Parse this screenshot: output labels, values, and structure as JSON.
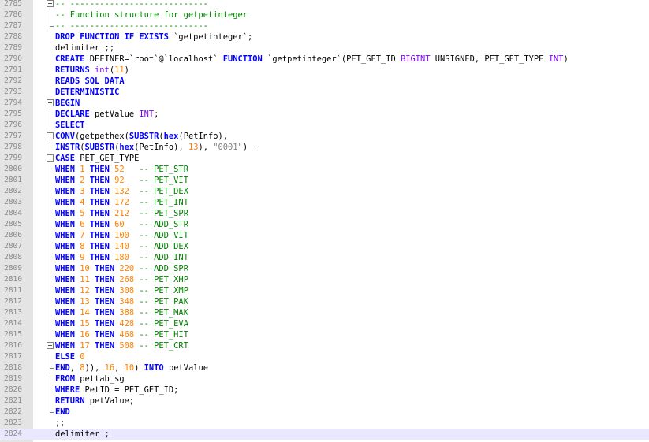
{
  "editor": {
    "lines": [
      {
        "n": "2785",
        "fold": "box",
        "tokens": [
          {
            "t": "cm",
            "v": "-- ----------------------------"
          }
        ]
      },
      {
        "n": "2786",
        "fold": "vline",
        "tokens": [
          {
            "t": "cm",
            "v": "-- Function structure for getpetinteger"
          }
        ]
      },
      {
        "n": "2787",
        "fold": "end",
        "tokens": [
          {
            "t": "cm",
            "v": "-- ----------------------------"
          }
        ]
      },
      {
        "n": "2788",
        "fold": "",
        "tokens": [
          {
            "t": "kw",
            "v": "DROP FUNCTION IF EXISTS "
          },
          {
            "t": "bq",
            "v": "`getpetinteger`"
          },
          {
            "t": "tx",
            "v": ";"
          }
        ]
      },
      {
        "n": "2789",
        "fold": "",
        "tokens": [
          {
            "t": "tx",
            "v": "delimiter ;;"
          }
        ]
      },
      {
        "n": "2790",
        "fold": "",
        "tokens": [
          {
            "t": "kw",
            "v": "CREATE "
          },
          {
            "t": "tx",
            "v": "DEFINER="
          },
          {
            "t": "bq",
            "v": "`root`"
          },
          {
            "t": "tx",
            "v": "@"
          },
          {
            "t": "bq",
            "v": "`localhost`"
          },
          {
            "t": "tx",
            "v": " "
          },
          {
            "t": "kw",
            "v": "FUNCTION "
          },
          {
            "t": "bq",
            "v": "`getpetinteger`"
          },
          {
            "t": "tx",
            "v": "(PET_GET_ID "
          },
          {
            "t": "ty",
            "v": "BIGINT"
          },
          {
            "t": "tx",
            "v": " UNSIGNED, PET_GET_TYPE "
          },
          {
            "t": "ty",
            "v": "INT"
          },
          {
            "t": "tx",
            "v": ")"
          }
        ]
      },
      {
        "n": "2791",
        "fold": "",
        "tokens": [
          {
            "t": "kw",
            "v": "RETURNS "
          },
          {
            "t": "ty",
            "v": "int"
          },
          {
            "t": "tx",
            "v": "("
          },
          {
            "t": "num",
            "v": "11"
          },
          {
            "t": "tx",
            "v": ")"
          }
        ]
      },
      {
        "n": "2792",
        "fold": "",
        "tokens": [
          {
            "t": "kw",
            "v": "READS SQL DATA"
          }
        ]
      },
      {
        "n": "2793",
        "fold": "",
        "tokens": [
          {
            "t": "kw",
            "v": "DETERMINISTIC"
          }
        ]
      },
      {
        "n": "2794",
        "fold": "box",
        "tokens": [
          {
            "t": "kw",
            "v": "BEGIN"
          }
        ]
      },
      {
        "n": "2795",
        "fold": "vline",
        "tokens": [
          {
            "t": "kw",
            "v": "DECLARE "
          },
          {
            "t": "tx",
            "v": "petValue "
          },
          {
            "t": "ty",
            "v": "INT"
          },
          {
            "t": "tx",
            "v": ";"
          }
        ]
      },
      {
        "n": "2796",
        "fold": "vline",
        "tokens": [
          {
            "t": "kw",
            "v": "SELECT"
          }
        ]
      },
      {
        "n": "2797",
        "fold": "box",
        "tokens": [
          {
            "t": "kw",
            "v": "CONV"
          },
          {
            "t": "tx",
            "v": "(getpethex("
          },
          {
            "t": "kw",
            "v": "SUBSTR"
          },
          {
            "t": "tx",
            "v": "("
          },
          {
            "t": "kw",
            "v": "hex"
          },
          {
            "t": "tx",
            "v": "(PetInfo),"
          }
        ]
      },
      {
        "n": "2798",
        "fold": "vline",
        "tokens": [
          {
            "t": "kw",
            "v": "INSTR"
          },
          {
            "t": "tx",
            "v": "("
          },
          {
            "t": "kw",
            "v": "SUBSTR"
          },
          {
            "t": "tx",
            "v": "("
          },
          {
            "t": "kw",
            "v": "hex"
          },
          {
            "t": "tx",
            "v": "(PetInfo), "
          },
          {
            "t": "num",
            "v": "13"
          },
          {
            "t": "tx",
            "v": "), "
          },
          {
            "t": "str",
            "v": "\"0001\""
          },
          {
            "t": "tx",
            "v": ") +"
          }
        ]
      },
      {
        "n": "2799",
        "fold": "box",
        "tokens": [
          {
            "t": "kw",
            "v": "CASE "
          },
          {
            "t": "tx",
            "v": "PET_GET_TYPE"
          }
        ]
      },
      {
        "n": "2800",
        "fold": "vline",
        "tokens": [
          {
            "t": "kw",
            "v": "WHEN "
          },
          {
            "t": "num",
            "v": "1"
          },
          {
            "t": "kw",
            "v": " THEN "
          },
          {
            "t": "num",
            "v": "52"
          },
          {
            "t": "tx",
            "v": "   "
          },
          {
            "t": "cm",
            "v": "-- PET_STR"
          }
        ]
      },
      {
        "n": "2801",
        "fold": "vline",
        "tokens": [
          {
            "t": "kw",
            "v": "WHEN "
          },
          {
            "t": "num",
            "v": "2"
          },
          {
            "t": "kw",
            "v": " THEN "
          },
          {
            "t": "num",
            "v": "92"
          },
          {
            "t": "tx",
            "v": "   "
          },
          {
            "t": "cm",
            "v": "-- PET_VIT"
          }
        ]
      },
      {
        "n": "2802",
        "fold": "vline",
        "tokens": [
          {
            "t": "kw",
            "v": "WHEN "
          },
          {
            "t": "num",
            "v": "3"
          },
          {
            "t": "kw",
            "v": " THEN "
          },
          {
            "t": "num",
            "v": "132"
          },
          {
            "t": "tx",
            "v": "  "
          },
          {
            "t": "cm",
            "v": "-- PET_DEX"
          }
        ]
      },
      {
        "n": "2803",
        "fold": "vline",
        "tokens": [
          {
            "t": "kw",
            "v": "WHEN "
          },
          {
            "t": "num",
            "v": "4"
          },
          {
            "t": "kw",
            "v": " THEN "
          },
          {
            "t": "num",
            "v": "172"
          },
          {
            "t": "tx",
            "v": "  "
          },
          {
            "t": "cm",
            "v": "-- PET_INT"
          }
        ]
      },
      {
        "n": "2804",
        "fold": "vline",
        "tokens": [
          {
            "t": "kw",
            "v": "WHEN "
          },
          {
            "t": "num",
            "v": "5"
          },
          {
            "t": "kw",
            "v": " THEN "
          },
          {
            "t": "num",
            "v": "212"
          },
          {
            "t": "tx",
            "v": "  "
          },
          {
            "t": "cm",
            "v": "-- PET_SPR"
          }
        ]
      },
      {
        "n": "2805",
        "fold": "vline",
        "tokens": [
          {
            "t": "kw",
            "v": "WHEN "
          },
          {
            "t": "num",
            "v": "6"
          },
          {
            "t": "kw",
            "v": " THEN "
          },
          {
            "t": "num",
            "v": "60"
          },
          {
            "t": "tx",
            "v": "   "
          },
          {
            "t": "cm",
            "v": "-- ADD_STR"
          }
        ]
      },
      {
        "n": "2806",
        "fold": "vline",
        "tokens": [
          {
            "t": "kw",
            "v": "WHEN "
          },
          {
            "t": "num",
            "v": "7"
          },
          {
            "t": "kw",
            "v": " THEN "
          },
          {
            "t": "num",
            "v": "100"
          },
          {
            "t": "tx",
            "v": "  "
          },
          {
            "t": "cm",
            "v": "-- ADD_VIT"
          }
        ]
      },
      {
        "n": "2807",
        "fold": "vline",
        "tokens": [
          {
            "t": "kw",
            "v": "WHEN "
          },
          {
            "t": "num",
            "v": "8"
          },
          {
            "t": "kw",
            "v": " THEN "
          },
          {
            "t": "num",
            "v": "140"
          },
          {
            "t": "tx",
            "v": "  "
          },
          {
            "t": "cm",
            "v": "-- ADD_DEX"
          }
        ]
      },
      {
        "n": "2808",
        "fold": "vline",
        "tokens": [
          {
            "t": "kw",
            "v": "WHEN "
          },
          {
            "t": "num",
            "v": "9"
          },
          {
            "t": "kw",
            "v": " THEN "
          },
          {
            "t": "num",
            "v": "180"
          },
          {
            "t": "tx",
            "v": "  "
          },
          {
            "t": "cm",
            "v": "-- ADD_INT"
          }
        ]
      },
      {
        "n": "2809",
        "fold": "vline",
        "tokens": [
          {
            "t": "kw",
            "v": "WHEN "
          },
          {
            "t": "num",
            "v": "10"
          },
          {
            "t": "kw",
            "v": " THEN "
          },
          {
            "t": "num",
            "v": "220"
          },
          {
            "t": "tx",
            "v": " "
          },
          {
            "t": "cm",
            "v": "-- ADD_SPR"
          }
        ]
      },
      {
        "n": "2810",
        "fold": "vline",
        "tokens": [
          {
            "t": "kw",
            "v": "WHEN "
          },
          {
            "t": "num",
            "v": "11"
          },
          {
            "t": "kw",
            "v": " THEN "
          },
          {
            "t": "num",
            "v": "268"
          },
          {
            "t": "tx",
            "v": " "
          },
          {
            "t": "cm",
            "v": "-- PET_XHP"
          }
        ]
      },
      {
        "n": "2811",
        "fold": "vline",
        "tokens": [
          {
            "t": "kw",
            "v": "WHEN "
          },
          {
            "t": "num",
            "v": "12"
          },
          {
            "t": "kw",
            "v": " THEN "
          },
          {
            "t": "num",
            "v": "308"
          },
          {
            "t": "tx",
            "v": " "
          },
          {
            "t": "cm",
            "v": "-- PET_XMP"
          }
        ]
      },
      {
        "n": "2812",
        "fold": "vline",
        "tokens": [
          {
            "t": "kw",
            "v": "WHEN "
          },
          {
            "t": "num",
            "v": "13"
          },
          {
            "t": "kw",
            "v": " THEN "
          },
          {
            "t": "num",
            "v": "348"
          },
          {
            "t": "tx",
            "v": " "
          },
          {
            "t": "cm",
            "v": "-- PET_PAK"
          }
        ]
      },
      {
        "n": "2813",
        "fold": "vline",
        "tokens": [
          {
            "t": "kw",
            "v": "WHEN "
          },
          {
            "t": "num",
            "v": "14"
          },
          {
            "t": "kw",
            "v": " THEN "
          },
          {
            "t": "num",
            "v": "388"
          },
          {
            "t": "tx",
            "v": " "
          },
          {
            "t": "cm",
            "v": "-- PET_MAK"
          }
        ]
      },
      {
        "n": "2814",
        "fold": "vline",
        "tokens": [
          {
            "t": "kw",
            "v": "WHEN "
          },
          {
            "t": "num",
            "v": "15"
          },
          {
            "t": "kw",
            "v": " THEN "
          },
          {
            "t": "num",
            "v": "428"
          },
          {
            "t": "tx",
            "v": " "
          },
          {
            "t": "cm",
            "v": "-- PET_EVA"
          }
        ]
      },
      {
        "n": "2815",
        "fold": "vline",
        "tokens": [
          {
            "t": "kw",
            "v": "WHEN "
          },
          {
            "t": "num",
            "v": "16"
          },
          {
            "t": "kw",
            "v": " THEN "
          },
          {
            "t": "num",
            "v": "468"
          },
          {
            "t": "tx",
            "v": " "
          },
          {
            "t": "cm",
            "v": "-- PET_HIT"
          }
        ]
      },
      {
        "n": "2816",
        "fold": "box",
        "tokens": [
          {
            "t": "kw",
            "v": "WHEN "
          },
          {
            "t": "num",
            "v": "17"
          },
          {
            "t": "kw",
            "v": " THEN "
          },
          {
            "t": "num",
            "v": "508"
          },
          {
            "t": "tx",
            "v": " "
          },
          {
            "t": "cm",
            "v": "-- PET_CRT"
          }
        ]
      },
      {
        "n": "2817",
        "fold": "vline",
        "tokens": [
          {
            "t": "kw",
            "v": "ELSE "
          },
          {
            "t": "num",
            "v": "0"
          }
        ]
      },
      {
        "n": "2818",
        "fold": "end",
        "tokens": [
          {
            "t": "kw",
            "v": "END"
          },
          {
            "t": "tx",
            "v": ", "
          },
          {
            "t": "num",
            "v": "8"
          },
          {
            "t": "tx",
            "v": ")), "
          },
          {
            "t": "num",
            "v": "16"
          },
          {
            "t": "tx",
            "v": ", "
          },
          {
            "t": "num",
            "v": "10"
          },
          {
            "t": "tx",
            "v": ") "
          },
          {
            "t": "kw",
            "v": "INTO "
          },
          {
            "t": "tx",
            "v": "petValue"
          }
        ]
      },
      {
        "n": "2819",
        "fold": "vline",
        "tokens": [
          {
            "t": "kw",
            "v": "FROM "
          },
          {
            "t": "tx",
            "v": "pettab_sg"
          }
        ]
      },
      {
        "n": "2820",
        "fold": "vline",
        "tokens": [
          {
            "t": "kw",
            "v": "WHERE "
          },
          {
            "t": "tx",
            "v": "PetID = PET_GET_ID;"
          }
        ]
      },
      {
        "n": "2821",
        "fold": "vline",
        "tokens": [
          {
            "t": "kw",
            "v": "RETURN "
          },
          {
            "t": "tx",
            "v": "petValue;"
          }
        ]
      },
      {
        "n": "2822",
        "fold": "end",
        "tokens": [
          {
            "t": "kw",
            "v": "END"
          }
        ]
      },
      {
        "n": "2823",
        "fold": "",
        "tokens": [
          {
            "t": "tx",
            "v": ";;"
          }
        ]
      },
      {
        "n": "2824",
        "fold": "",
        "current": true,
        "tokens": [
          {
            "t": "tx",
            "v": "delimiter ;"
          }
        ]
      }
    ]
  }
}
